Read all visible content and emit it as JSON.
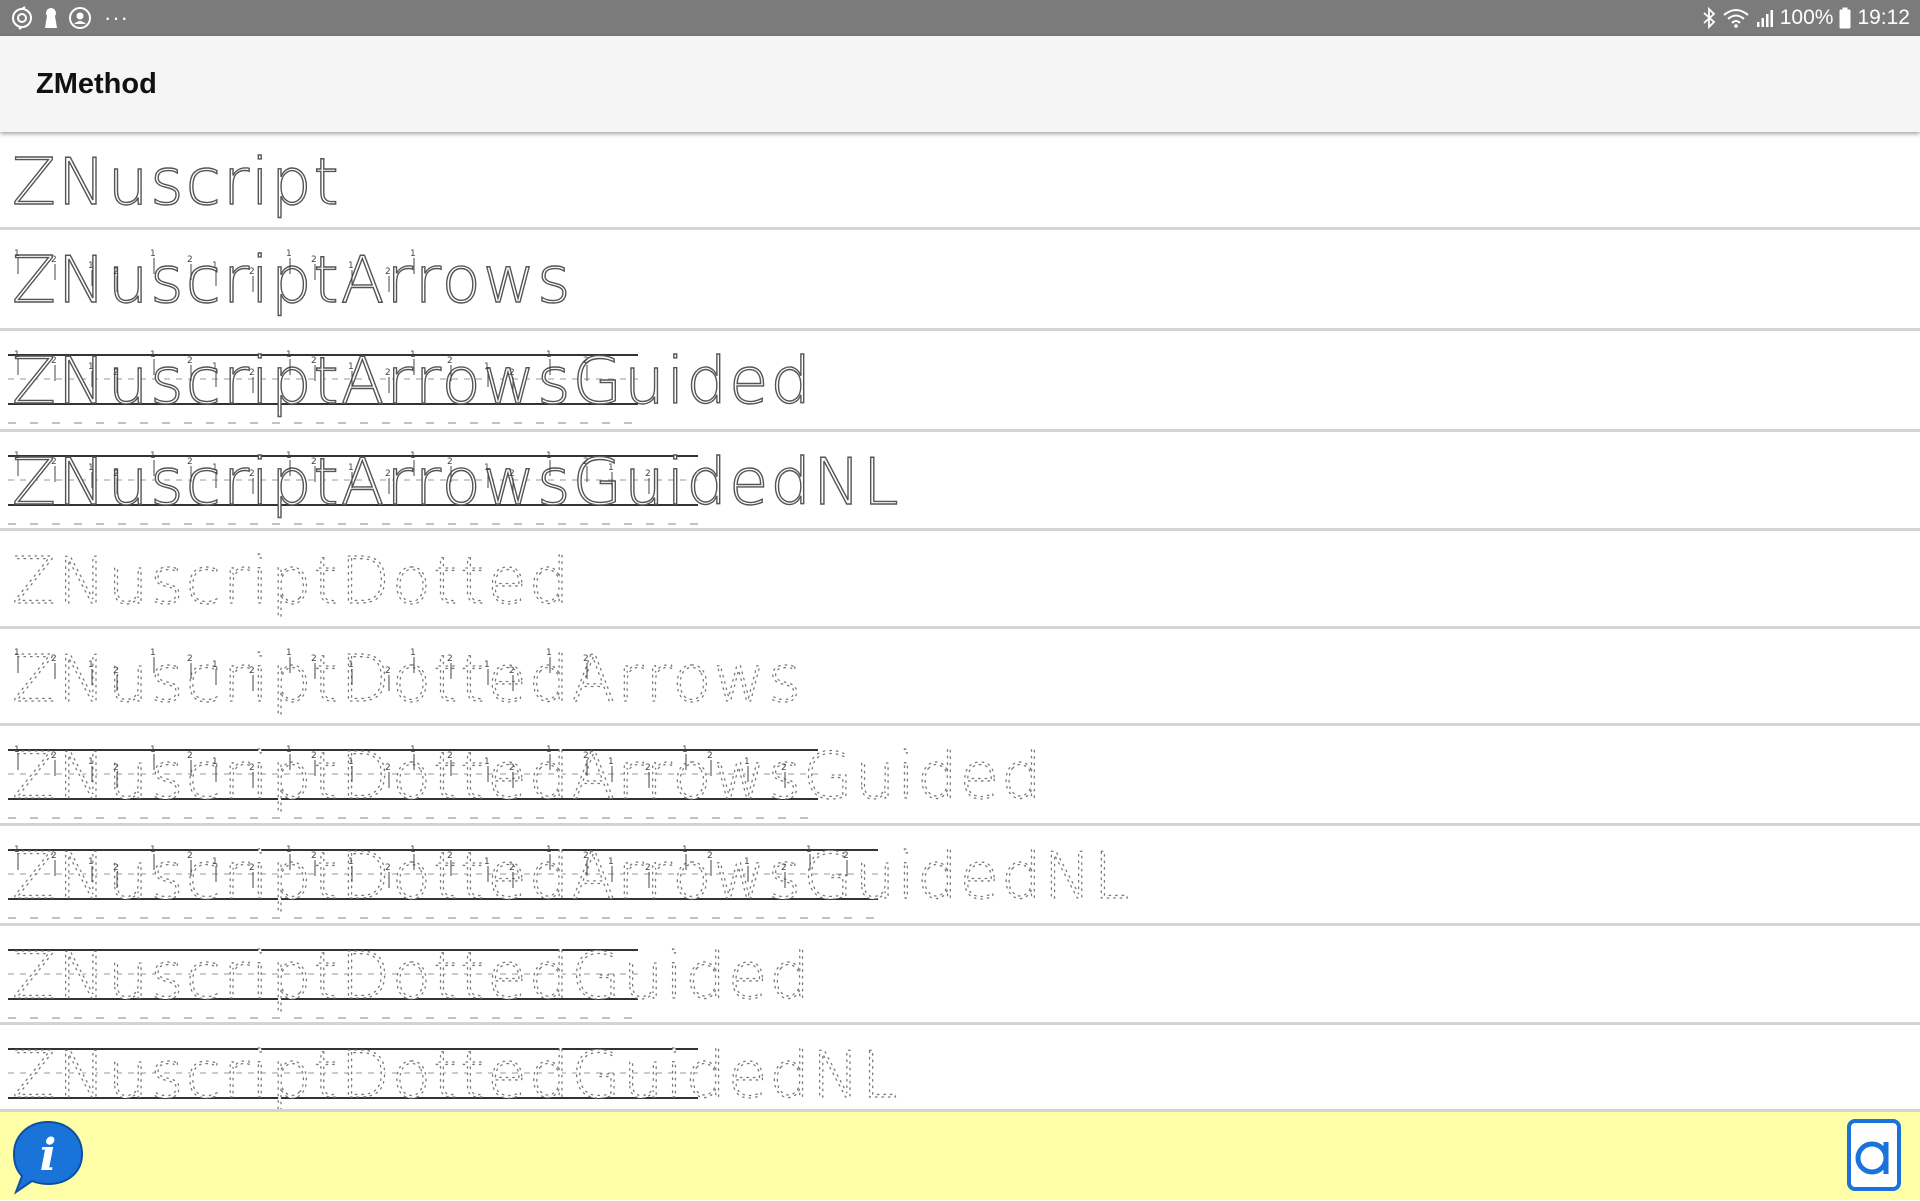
{
  "status_bar": {
    "left_icons": [
      "sync-icon",
      "keyhole-icon",
      "account-icon"
    ],
    "more": "···",
    "battery_percent": "100%",
    "time": "19:12",
    "right_icons": [
      "bluetooth-icon",
      "wifi-icon",
      "signal-icon",
      "battery-icon"
    ]
  },
  "app_bar": {
    "title": "ZMethod"
  },
  "font_list": {
    "items": [
      {
        "name": "ZNuscript",
        "style": "solid",
        "arrows": false,
        "guided": false
      },
      {
        "name": "ZNuscriptArrows",
        "style": "solid",
        "arrows": true,
        "guided": false
      },
      {
        "name": "ZNuscriptArrowsGuided",
        "style": "solid",
        "arrows": true,
        "guided": true
      },
      {
        "name": "ZNuscriptArrowsGuidedNL",
        "style": "solid",
        "arrows": true,
        "guided": true
      },
      {
        "name": "ZNuscriptDotted",
        "style": "dotted",
        "arrows": false,
        "guided": false
      },
      {
        "name": "ZNuscriptDottedArrows",
        "style": "dotted",
        "arrows": true,
        "guided": false
      },
      {
        "name": "ZNuscriptDottedArrowsGuided",
        "style": "dotted",
        "arrows": true,
        "guided": true
      },
      {
        "name": "ZNuscriptDottedArrowsGuidedNL",
        "style": "dotted",
        "arrows": true,
        "guided": true
      },
      {
        "name": "ZNuscriptDottedGuided",
        "style": "dotted",
        "arrows": false,
        "guided": true
      },
      {
        "name": "ZNuscriptDottedGuidedNL",
        "style": "dotted",
        "arrows": false,
        "guided": true
      }
    ]
  },
  "bottom_bar": {
    "info_icon": "info-speech-bubble-icon",
    "info_letter": "i",
    "app_icon": "letter-a-icon",
    "colors": {
      "background": "#ffffa8",
      "icon_blue": "#1a73d9"
    }
  }
}
